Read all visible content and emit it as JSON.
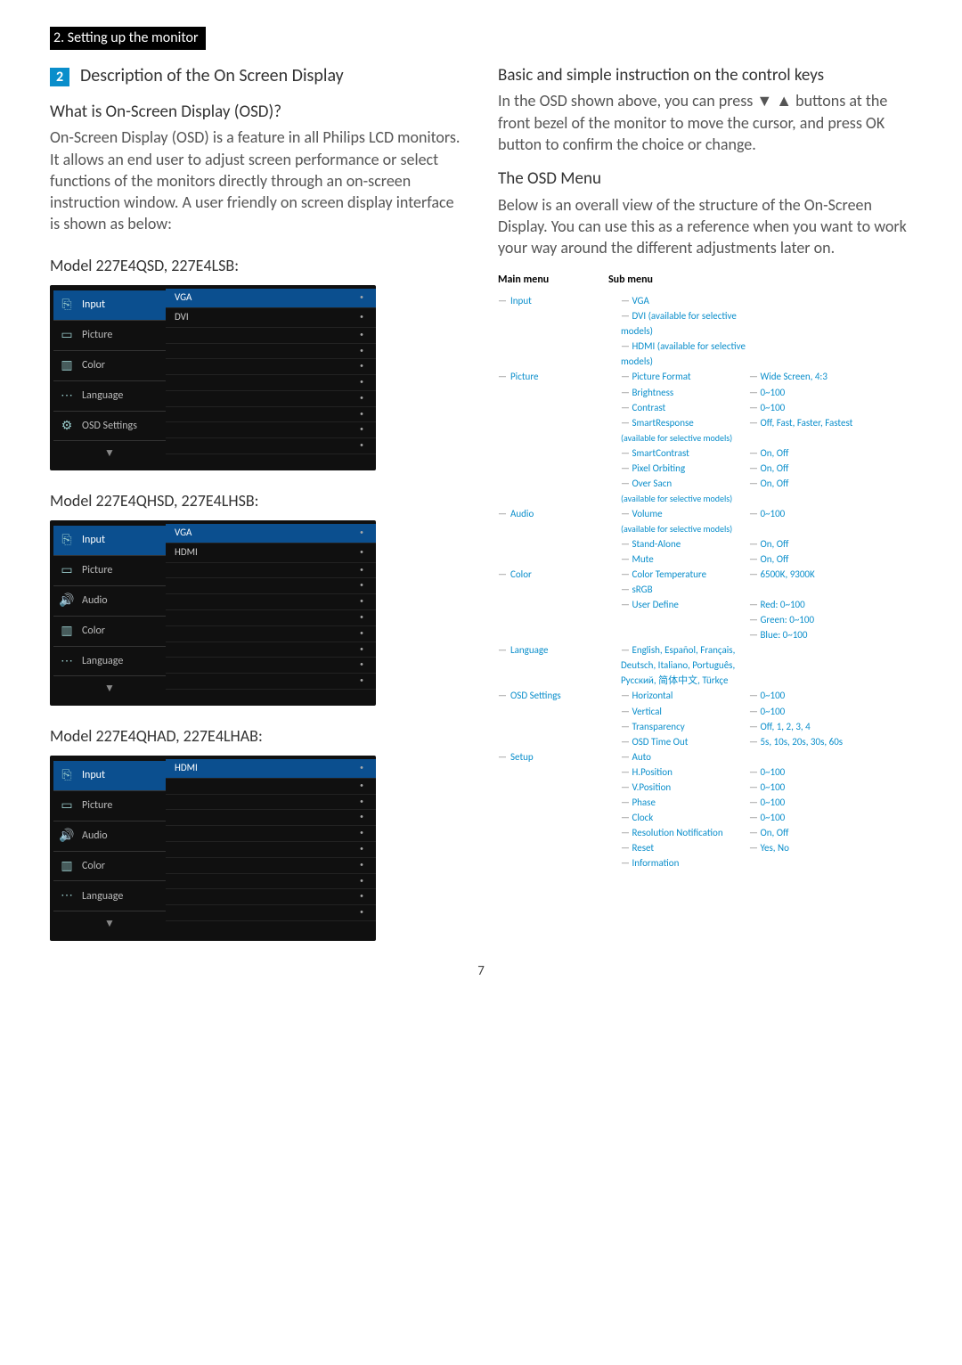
{
  "breadcrumb": "2. Setting up the monitor",
  "section_num": "2",
  "section_title": "Description of the On Screen Display",
  "q1_heading": "What is On-Screen Display (OSD)?",
  "q1_body": "On-Screen Display (OSD) is a feature in all Philips LCD monitors. It allows an end user to adjust screen performance or select functions of the monitors directly through an on-screen instruction window. A user friendly on screen display interface is shown as below:",
  "model1_label": "Model 227E4QSD, 227E4LSB:",
  "model2_label": "Model 227E4QHSD, 227E4LHSB:",
  "model3_label": "Model 227E4QHAD, 227E4LHAB:",
  "osd1": {
    "items": [
      "Input",
      "Picture",
      "Color",
      "Language",
      "OSD Settings"
    ],
    "opts": [
      "VGA",
      "DVI"
    ]
  },
  "osd2": {
    "items": [
      "Input",
      "Picture",
      "Audio",
      "Color",
      "Language"
    ],
    "opts": [
      "VGA",
      "HDMI"
    ]
  },
  "osd3": {
    "items": [
      "Input",
      "Picture",
      "Audio",
      "Color",
      "Language"
    ],
    "opts": [
      "HDMI"
    ]
  },
  "right": {
    "h1": "Basic and simple instruction on the control keys",
    "p1": "In the OSD shown above, you can press ▼ ▲ buttons at the front bezel of the monitor to move the cursor, and press OK button to confirm the choice or change.",
    "h2": "The OSD Menu",
    "p2": "Below is an overall view of the structure of the On-Screen Display. You can use this as a reference when you want to work your way around the different adjustments later on."
  },
  "tree_headers": {
    "main": "Main menu",
    "sub": "Sub menu"
  },
  "tree": [
    {
      "label": "Input",
      "subs": [
        {
          "label": "VGA"
        },
        {
          "label": "DVI (available for selective models)"
        },
        {
          "label": "HDMI (available for selective models)"
        }
      ]
    },
    {
      "label": "Picture",
      "subs": [
        {
          "label": "Picture Format",
          "val": "Wide Screen, 4:3"
        },
        {
          "label": "Brightness",
          "val": "0~100"
        },
        {
          "label": "Contrast",
          "val": "0~100"
        },
        {
          "label": "SmartResponse",
          "note": "(available for selective models)",
          "val": "Off, Fast, Faster, Fastest"
        },
        {
          "label": "SmartContrast",
          "val": "On, Off"
        },
        {
          "label": "Pixel Orbiting",
          "val": "On, Off"
        },
        {
          "label": "Over Sacn",
          "note": "(available for selective models)",
          "val": "On, Off"
        }
      ]
    },
    {
      "label": "Audio",
      "subs": [
        {
          "label": "Volume",
          "note": "(available for selective models)",
          "val": "0~100"
        },
        {
          "label": "Stand-Alone",
          "val": "On, Off"
        },
        {
          "label": "Mute",
          "val": "On, Off"
        }
      ]
    },
    {
      "label": "Color",
      "subs": [
        {
          "label": "Color Temperature",
          "val": "6500K, 9300K"
        },
        {
          "label": "sRGB"
        },
        {
          "label": "User Define",
          "vals": [
            "Red: 0~100",
            "Green: 0~100",
            "Blue: 0~100"
          ]
        }
      ]
    },
    {
      "label": "Language",
      "subs": [
        {
          "label": "English, Español, Français, Deutsch, Italiano, Português, Русский, 简体中文, Türkçe"
        }
      ]
    },
    {
      "label": "OSD Settings",
      "subs": [
        {
          "label": "Horizontal",
          "val": "0~100"
        },
        {
          "label": "Vertical",
          "val": "0~100"
        },
        {
          "label": "Transparency",
          "val": "Off, 1, 2, 3, 4"
        },
        {
          "label": "OSD Time Out",
          "val": "5s, 10s, 20s, 30s, 60s"
        }
      ]
    },
    {
      "label": "Setup",
      "subs": [
        {
          "label": "Auto"
        },
        {
          "label": "H.Position",
          "val": "0~100"
        },
        {
          "label": "V.Position",
          "val": "0~100"
        },
        {
          "label": "Phase",
          "val": "0~100"
        },
        {
          "label": "Clock",
          "val": "0~100"
        },
        {
          "label": "Resolution Notification",
          "val": "On, Off"
        },
        {
          "label": "Reset",
          "val": "Yes, No"
        },
        {
          "label": "Information"
        }
      ]
    }
  ],
  "icons": [
    "⎘",
    "▭",
    "🔊",
    "▥",
    "⋯",
    "⚙"
  ],
  "page_number": "7"
}
